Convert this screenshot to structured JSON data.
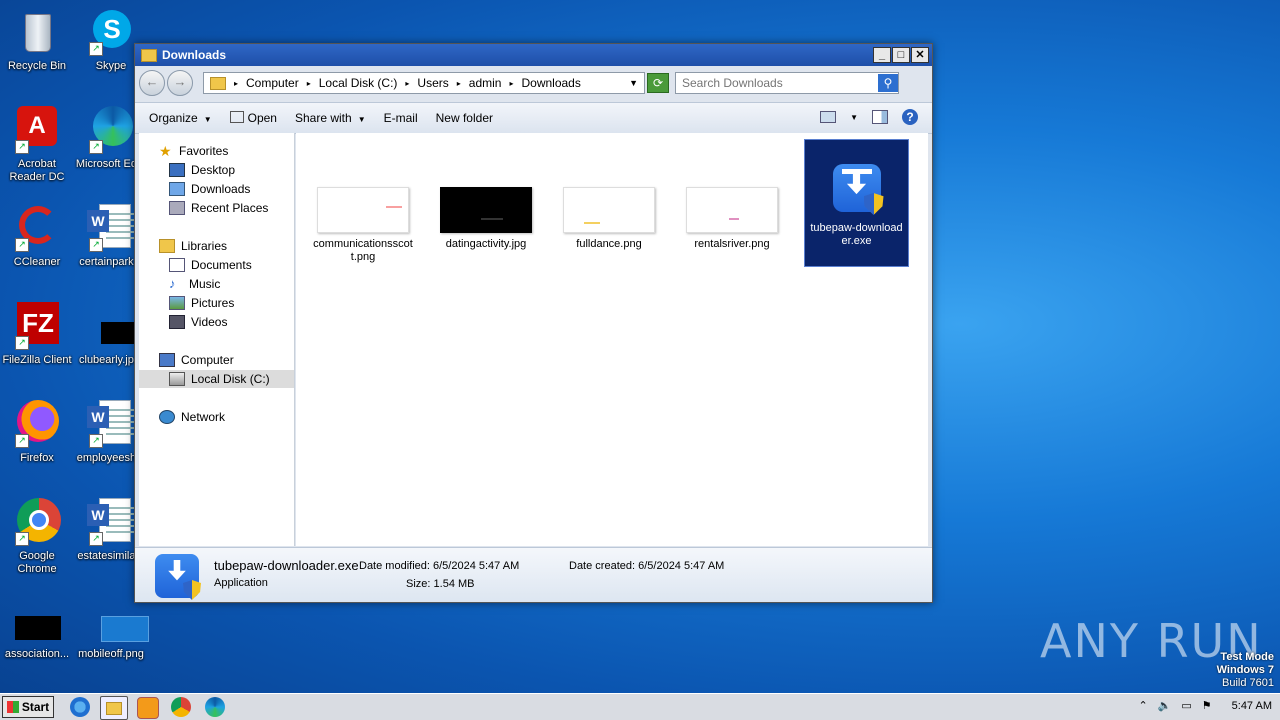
{
  "desktop": {
    "icons": [
      {
        "label": "Recycle Bin"
      },
      {
        "label": "Skype"
      },
      {
        "label": "Acrobat Reader DC"
      },
      {
        "label": "Microsoft Ed..."
      },
      {
        "label": "CCleaner"
      },
      {
        "label": "certainpark..."
      },
      {
        "label": "FileZilla Client"
      },
      {
        "label": "clubearly.jp..."
      },
      {
        "label": "Firefox"
      },
      {
        "label": "employeesh..."
      },
      {
        "label": "Google Chrome"
      },
      {
        "label": "estatesimila..."
      },
      {
        "label": "association..."
      },
      {
        "label": "mobileoff.png"
      }
    ]
  },
  "window": {
    "title": "Downloads",
    "breadcrumb": [
      "Computer",
      "Local Disk (C:)",
      "Users",
      "admin",
      "Downloads"
    ],
    "search_placeholder": "Search Downloads",
    "toolbar": {
      "organize": "Organize",
      "open": "Open",
      "share_with": "Share with",
      "email": "E-mail",
      "new_folder": "New folder"
    },
    "nav": {
      "favorites": "Favorites",
      "desktop": "Desktop",
      "downloads": "Downloads",
      "recent_places": "Recent Places",
      "libraries": "Libraries",
      "documents": "Documents",
      "music": "Music",
      "pictures": "Pictures",
      "videos": "Videos",
      "computer": "Computer",
      "local_disk": "Local Disk (C:)",
      "network": "Network"
    },
    "files": [
      {
        "name": "communicationsscott.png"
      },
      {
        "name": "datingactivity.jpg"
      },
      {
        "name": "fulldance.png"
      },
      {
        "name": "rentalsriver.png"
      },
      {
        "name": "tubepaw-downloader.exe"
      }
    ],
    "details": {
      "filename": "tubepaw-downloader.exe",
      "type": "Application",
      "date_modified_label": "Date modified:",
      "date_modified": "6/5/2024 5:47 AM",
      "size_label": "Size:",
      "size": "1.54 MB",
      "date_created_label": "Date created:",
      "date_created": "6/5/2024 5:47 AM"
    }
  },
  "taskbar": {
    "start": "Start",
    "clock": "5:47 AM"
  },
  "watermark": {
    "line1": "Test Mode",
    "line2": "Windows 7",
    "line3": "Build 7601",
    "brand": "ANY RUN"
  }
}
